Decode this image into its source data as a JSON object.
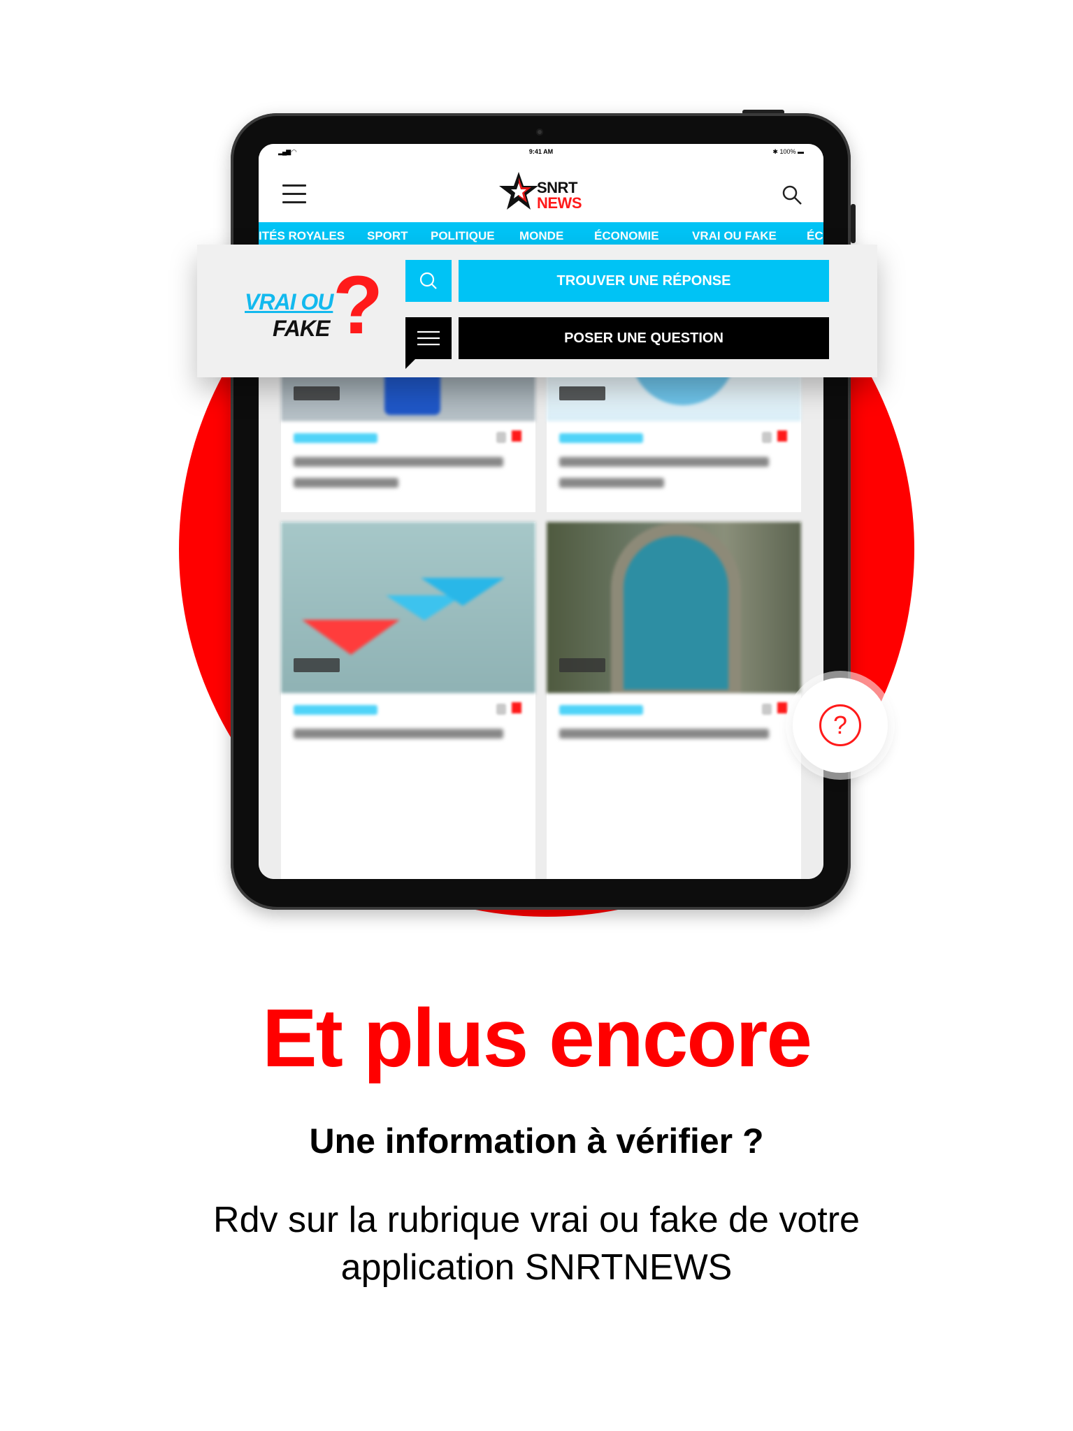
{
  "status_bar": {
    "time": "9:41 AM",
    "battery": "100%"
  },
  "header": {
    "brand_line1": "SNRT",
    "brand_line2": "NEWS"
  },
  "nav": {
    "items": [
      "ITÉS ROYALES",
      "SPORT",
      "POLITIQUE",
      "MONDE",
      "ÉCONOMIE",
      "VRAI OU FAKE",
      "ÉC"
    ]
  },
  "panel": {
    "logo_line1": "VRAI OU",
    "logo_line2": "FAKE",
    "logo_mark": "?",
    "find_label": "TROUVER UNE RÉPONSE",
    "ask_label": "POSER UNE QUESTION"
  },
  "fab": {
    "symbol": "?"
  },
  "promo": {
    "headline": "Et plus encore",
    "subheadline": "Une information à vérifier ?",
    "body": "Rdv sur la rubrique vrai ou fake de votre application SNRTNEWS"
  },
  "colors": {
    "accent_red": "#ff0000",
    "accent_cyan": "#00c3f5",
    "dark": "#000000"
  }
}
